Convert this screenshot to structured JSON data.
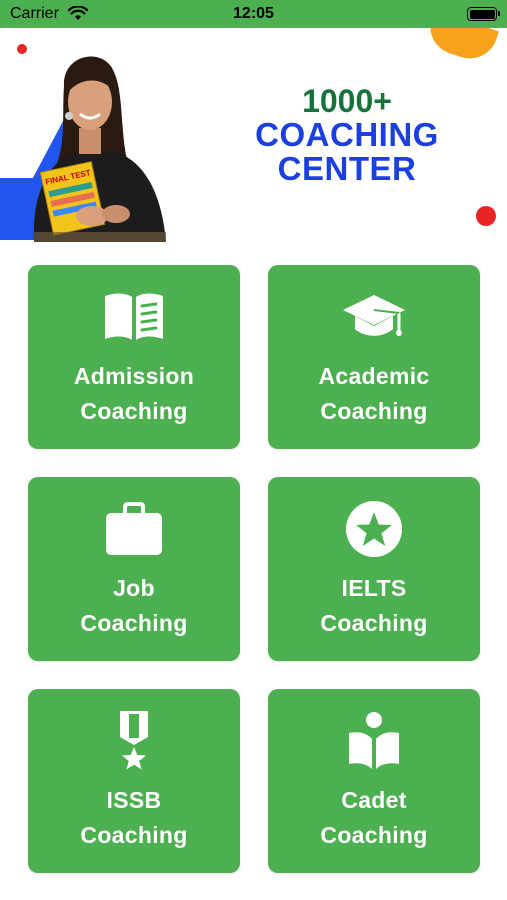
{
  "status_bar": {
    "carrier": "Carrier",
    "time": "12:05"
  },
  "banner": {
    "line1": "1000+",
    "line2": "COACHING",
    "line3": "CENTER",
    "book_text": "FINAL TEST"
  },
  "colors": {
    "tile": "#4caf50",
    "accent_blue": "#1c3fe0",
    "accent_green": "#17733a",
    "red_dot": "#e82424",
    "orange": "#f7a21b"
  },
  "tiles": [
    {
      "label": "Admission\nCoaching",
      "icon": "open-book-icon"
    },
    {
      "label": "Academic\nCoaching",
      "icon": "graduation-cap-icon"
    },
    {
      "label": "Job\nCoaching",
      "icon": "briefcase-icon"
    },
    {
      "label": "IELTS\nCoaching",
      "icon": "star-circle-icon"
    },
    {
      "label": "ISSB\nCoaching",
      "icon": "medal-icon"
    },
    {
      "label": "Cadet\nCoaching",
      "icon": "reader-icon"
    }
  ]
}
